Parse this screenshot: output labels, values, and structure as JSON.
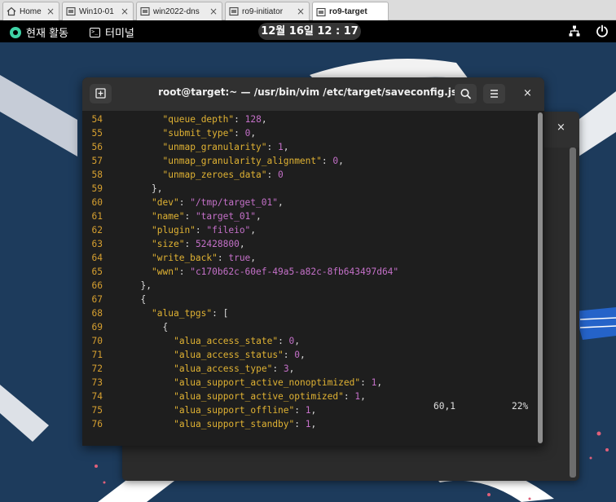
{
  "tabs": [
    {
      "label": "Home",
      "icon": "home-icon"
    },
    {
      "label": "Win10-01",
      "icon": "vm-icon"
    },
    {
      "label": "win2022-dns",
      "icon": "vm-icon"
    },
    {
      "label": "ro9-initiator",
      "icon": "vm-icon"
    },
    {
      "label": "ro9-target",
      "icon": "vm-icon"
    }
  ],
  "tab_close_glyph": "×",
  "topbar": {
    "activities": "현재 활동",
    "app_name": "터미널",
    "clock": "12월 16일  12 : 17"
  },
  "terminal": {
    "title": "root@target:~ — /usr/bin/vim /etc/target/saveconfig.json",
    "close_glyph": "×",
    "status_position": "60,1",
    "status_percent": "22%",
    "lines": [
      {
        "n": "54",
        "indent": 6,
        "parts": [
          [
            "key",
            "\"queue_depth\""
          ],
          [
            "pun",
            ": "
          ],
          [
            "num",
            "128"
          ],
          [
            "pun",
            ","
          ]
        ]
      },
      {
        "n": "55",
        "indent": 6,
        "parts": [
          [
            "key",
            "\"submit_type\""
          ],
          [
            "pun",
            ": "
          ],
          [
            "num",
            "0"
          ],
          [
            "pun",
            ","
          ]
        ]
      },
      {
        "n": "56",
        "indent": 6,
        "parts": [
          [
            "key",
            "\"unmap_granularity\""
          ],
          [
            "pun",
            ": "
          ],
          [
            "num",
            "1"
          ],
          [
            "pun",
            ","
          ]
        ]
      },
      {
        "n": "57",
        "indent": 6,
        "parts": [
          [
            "key",
            "\"unmap_granularity_alignment\""
          ],
          [
            "pun",
            ": "
          ],
          [
            "num",
            "0"
          ],
          [
            "pun",
            ","
          ]
        ]
      },
      {
        "n": "58",
        "indent": 6,
        "parts": [
          [
            "key",
            "\"unmap_zeroes_data\""
          ],
          [
            "pun",
            ": "
          ],
          [
            "num",
            "0"
          ]
        ]
      },
      {
        "n": "59",
        "indent": 4,
        "parts": [
          [
            "pun",
            "},"
          ]
        ]
      },
      {
        "n": "60",
        "indent": 4,
        "parts": [
          [
            "key",
            "\"dev\""
          ],
          [
            "pun",
            ": "
          ],
          [
            "str",
            "\"/tmp/target_01\""
          ],
          [
            "pun",
            ","
          ]
        ]
      },
      {
        "n": "61",
        "indent": 4,
        "parts": [
          [
            "key",
            "\"name\""
          ],
          [
            "pun",
            ": "
          ],
          [
            "str",
            "\"target_01\""
          ],
          [
            "pun",
            ","
          ]
        ]
      },
      {
        "n": "62",
        "indent": 4,
        "parts": [
          [
            "key",
            "\"plugin\""
          ],
          [
            "pun",
            ": "
          ],
          [
            "str",
            "\"fileio\""
          ],
          [
            "pun",
            ","
          ]
        ]
      },
      {
        "n": "63",
        "indent": 4,
        "parts": [
          [
            "key",
            "\"size\""
          ],
          [
            "pun",
            ": "
          ],
          [
            "num",
            "52428800"
          ],
          [
            "pun",
            ","
          ]
        ]
      },
      {
        "n": "64",
        "indent": 4,
        "parts": [
          [
            "key",
            "\"write_back\""
          ],
          [
            "pun",
            ": "
          ],
          [
            "num",
            "true"
          ],
          [
            "pun",
            ","
          ]
        ]
      },
      {
        "n": "65",
        "indent": 4,
        "parts": [
          [
            "key",
            "\"wwn\""
          ],
          [
            "pun",
            ": "
          ],
          [
            "str",
            "\"c170b62c-60ef-49a5-a82c-8fb643497d64\""
          ]
        ]
      },
      {
        "n": "66",
        "indent": 2,
        "parts": [
          [
            "pun",
            "},"
          ]
        ]
      },
      {
        "n": "67",
        "indent": 2,
        "parts": [
          [
            "pun",
            "{"
          ]
        ]
      },
      {
        "n": "68",
        "indent": 4,
        "parts": [
          [
            "key",
            "\"alua_tpgs\""
          ],
          [
            "pun",
            ": ["
          ]
        ]
      },
      {
        "n": "69",
        "indent": 6,
        "parts": [
          [
            "pun",
            "{"
          ]
        ]
      },
      {
        "n": "70",
        "indent": 8,
        "parts": [
          [
            "key",
            "\"alua_access_state\""
          ],
          [
            "pun",
            ": "
          ],
          [
            "num",
            "0"
          ],
          [
            "pun",
            ","
          ]
        ]
      },
      {
        "n": "71",
        "indent": 8,
        "parts": [
          [
            "key",
            "\"alua_access_status\""
          ],
          [
            "pun",
            ": "
          ],
          [
            "num",
            "0"
          ],
          [
            "pun",
            ","
          ]
        ]
      },
      {
        "n": "72",
        "indent": 8,
        "parts": [
          [
            "key",
            "\"alua_access_type\""
          ],
          [
            "pun",
            ": "
          ],
          [
            "num",
            "3"
          ],
          [
            "pun",
            ","
          ]
        ]
      },
      {
        "n": "73",
        "indent": 8,
        "parts": [
          [
            "key",
            "\"alua_support_active_nonoptimized\""
          ],
          [
            "pun",
            ": "
          ],
          [
            "num",
            "1"
          ],
          [
            "pun",
            ","
          ]
        ]
      },
      {
        "n": "74",
        "indent": 8,
        "parts": [
          [
            "key",
            "\"alua_support_active_optimized\""
          ],
          [
            "pun",
            ": "
          ],
          [
            "num",
            "1"
          ],
          [
            "pun",
            ","
          ]
        ]
      },
      {
        "n": "75",
        "indent": 8,
        "parts": [
          [
            "key",
            "\"alua_support_offline\""
          ],
          [
            "pun",
            ": "
          ],
          [
            "num",
            "1"
          ],
          [
            "pun",
            ","
          ]
        ]
      },
      {
        "n": "76",
        "indent": 8,
        "parts": [
          [
            "key",
            "\"alua_support_standby\""
          ],
          [
            "pun",
            ": "
          ],
          [
            "num",
            "1"
          ],
          [
            "pun",
            ","
          ]
        ]
      }
    ]
  },
  "colors": {
    "line_number": "#d7a030",
    "json_key": "#e0b233",
    "json_value": "#c470c8",
    "wallpaper": "#1d3b5c"
  }
}
